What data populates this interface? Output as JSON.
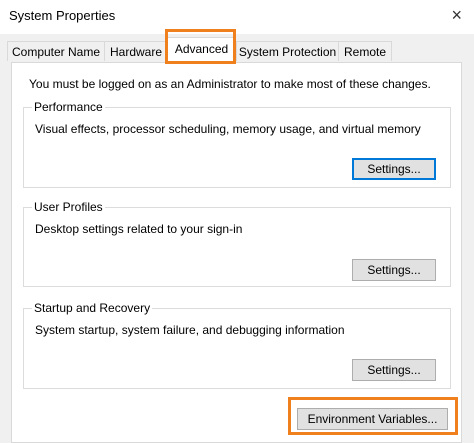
{
  "window": {
    "title": "System Properties",
    "close_glyph": "×"
  },
  "tabs": [
    {
      "label": "Computer Name"
    },
    {
      "label": "Hardware"
    },
    {
      "label": "Advanced",
      "active": true
    },
    {
      "label": "System Protection"
    },
    {
      "label": "Remote"
    }
  ],
  "advanced": {
    "admin_note": "You must be logged on as an Administrator to make most of these changes.",
    "performance": {
      "title": "Performance",
      "description": "Visual effects, processor scheduling, memory usage, and virtual memory",
      "button": "Settings..."
    },
    "user_profiles": {
      "title": "User Profiles",
      "description": "Desktop settings related to your sign-in",
      "button": "Settings..."
    },
    "startup_recovery": {
      "title": "Startup and Recovery",
      "description": "System startup, system failure, and debugging information",
      "button": "Settings..."
    },
    "env_button": "Environment Variables..."
  },
  "colors": {
    "highlight": "#f07f1e",
    "focus": "#0078d7",
    "dialog_bg": "#f0f0f0"
  }
}
